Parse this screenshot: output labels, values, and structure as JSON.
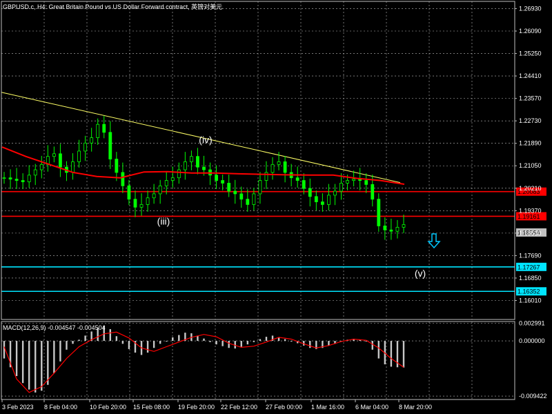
{
  "header": {
    "title": "GBPUSD.c, H4:  Great Britain Pound vs US Dollar Forward contract, 英镑对美元"
  },
  "macd_panel": {
    "title": "MACD(12,26,9) -0.004547 -0.004504"
  },
  "colors": {
    "background": "#000000",
    "grid": "#bfbfbf",
    "candles": "#00ff00",
    "moving_average": "#ff0000",
    "trendline": "#ffff66",
    "resistance_lines": "#ff0000",
    "target_lines": "#00e5ff",
    "macd_histogram": "#c8c8c8",
    "macd_signal": "#ff0000"
  },
  "chart_data": [
    {
      "type": "candlestick",
      "symbol": "GBPUSD.c",
      "timeframe": "H4",
      "y_ticks": [
        "1.26930",
        "1.26090",
        "1.25250",
        "1.24410",
        "1.23570",
        "1.22730",
        "1.21890",
        "1.21050",
        "1.20210",
        "1.19370",
        "1.18530",
        "1.17690",
        "1.16850",
        "1.16010"
      ],
      "ylim": [
        1.153,
        1.272
      ],
      "x_ticks": [
        "3 Feb 2023",
        "8 Feb 04:00",
        "10 Feb 20:00",
        "15 Feb 08:00",
        "19 Feb 20:00",
        "22 Feb 12:00",
        "27 Feb 00:00",
        "1 Mar 16:00",
        "6 Mar 04:00",
        "8 Mar 20:00"
      ],
      "current_price": {
        "label": "1.18554",
        "value": 1.18554
      },
      "horizontal_lines": [
        {
          "label": "1.20083",
          "value": 1.20083,
          "color": "#ff0000"
        },
        {
          "label": "1.19161",
          "value": 1.19161,
          "color": "#ff0000"
        },
        {
          "label": "1.17267",
          "value": 1.17267,
          "color": "#00e5ff"
        },
        {
          "label": "1.16352",
          "value": 1.16352,
          "color": "#00e5ff"
        }
      ],
      "wave_labels": [
        {
          "text": "(iv)",
          "value": 1.22
        },
        {
          "text": "(iii)",
          "value": 1.1895
        },
        {
          "text": "(v)",
          "value": 1.17
        }
      ],
      "trendline": {
        "start": 1.238,
        "end": 1.2042
      },
      "price_path": [
        1.206,
        1.2055,
        1.205,
        1.2045,
        1.207,
        1.209,
        1.211,
        1.214,
        1.215,
        1.21,
        1.208,
        1.212,
        1.216,
        1.219,
        1.221,
        1.226,
        1.223,
        1.213,
        1.208,
        1.203,
        1.198,
        1.195,
        1.196,
        1.1985,
        1.2,
        1.203,
        1.205,
        1.206,
        1.209,
        1.212,
        1.214,
        1.21,
        1.209,
        1.207,
        1.205,
        1.204,
        1.201,
        1.2,
        1.198,
        1.196,
        1.2,
        1.205,
        1.208,
        1.211,
        1.212,
        1.208,
        1.206,
        1.205,
        1.202,
        1.199,
        1.197,
        1.196,
        1.1995,
        1.201,
        1.204,
        1.205,
        1.2055,
        1.205,
        1.2035,
        1.198,
        1.188,
        1.1865,
        1.186,
        1.1875,
        1.1885
      ],
      "moving_average_path": [
        1.2175,
        1.214,
        1.211,
        1.208,
        1.2065,
        1.206,
        1.2082,
        1.2083,
        1.2078,
        1.2078,
        1.2075,
        1.2073,
        1.2071,
        1.207,
        1.207,
        1.2058,
        1.205,
        1.2036
      ],
      "macd": {
        "y_ticks": [
          "0.002991",
          "0.000000",
          "-0.009422"
        ],
        "ylim": [
          -0.01,
          0.0033
        ],
        "histogram": [
          -0.003,
          -0.0045,
          -0.006,
          -0.0072,
          -0.0083,
          -0.0088,
          -0.0085,
          -0.0075,
          -0.0055,
          -0.0035,
          -0.0015,
          -0.0005,
          0.0002,
          0.0009,
          0.0016,
          0.0022,
          0.0026,
          0.002,
          0.0008,
          -0.0005,
          -0.0014,
          -0.002,
          -0.0024,
          -0.002,
          -0.0012,
          -0.0005,
          0.0,
          0.0006,
          0.001,
          0.0014,
          0.0013,
          0.0009,
          0.0004,
          -0.0002,
          -0.0006,
          -0.0009,
          -0.0012,
          -0.0013,
          -0.001,
          -0.0006,
          -0.0002,
          0.0003,
          0.0007,
          0.0009,
          0.0006,
          0.0003,
          0.0,
          -0.0004,
          -0.0008,
          -0.0012,
          -0.0014,
          -0.0012,
          -0.0008,
          -0.0005,
          -0.0001,
          0.0002,
          0.0003,
          0.0002,
          0.0,
          -0.0015,
          -0.003,
          -0.004,
          -0.0044,
          -0.0045,
          -0.00455
        ],
        "signal": [
          -0.001,
          -0.0065,
          -0.0088,
          -0.0078,
          -0.0055,
          -0.003,
          -0.001,
          0.0002,
          0.0012,
          0.0015,
          0.0005,
          -0.0012,
          -0.0018,
          -0.001,
          -0.0002,
          0.0006,
          0.0011,
          0.0007,
          -0.0004,
          -0.0011,
          -0.0009,
          -0.0002,
          0.0006,
          0.0003,
          -0.0005,
          -0.0012,
          -0.0008,
          -0.0001,
          0.0003,
          0.0001,
          -0.0012,
          -0.003,
          -0.0045
        ]
      }
    }
  ]
}
